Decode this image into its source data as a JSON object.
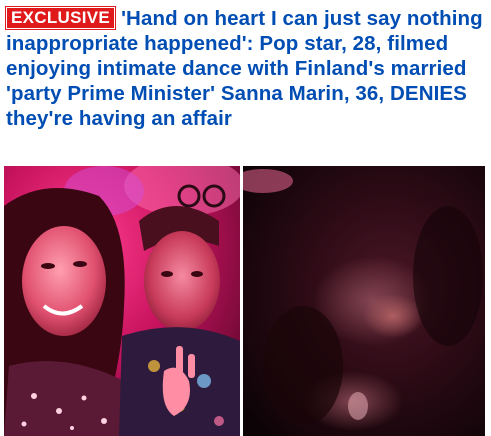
{
  "article": {
    "badge": "EXCLUSIVE",
    "headline": "'Hand on heart I can just say nothing inappropriate happened': Pop star, 28, filmed enjoying intimate dance with Finland's married 'party Prime Minister' Sanna Marin, 36, DENIES they're having an affair",
    "colors": {
      "headline": "#004db3",
      "badge_bg": "#e01a1a",
      "badge_text": "#ffffff"
    }
  },
  "images": [
    {
      "kind": "photo",
      "subject": "selfie-of-two-people-under-pink-light"
    },
    {
      "kind": "photo",
      "subject": "dark-blurry-video-still-of-dancing"
    }
  ]
}
